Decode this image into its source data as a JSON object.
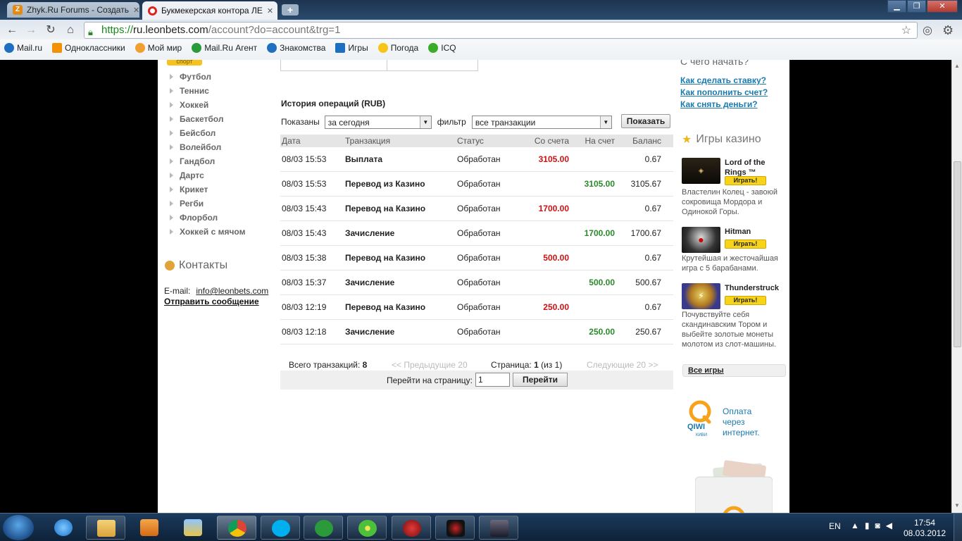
{
  "browser": {
    "tabs": [
      {
        "label": "Zhyk.Ru Forums - Создать"
      },
      {
        "label": "Букмекерская контора ЛЕ"
      }
    ],
    "url_scheme": "https://",
    "url_host": "ru.leonbets.com",
    "url_rest": "/account?do=account&trg=1",
    "bookmarks": [
      {
        "label": "Mail.ru",
        "color": "#1e6fbf"
      },
      {
        "label": "Одноклассники",
        "color": "#f39200"
      },
      {
        "label": "Мой мир",
        "color": "#f0a030"
      },
      {
        "label": "Mail.Ru Агент",
        "color": "#2a9a3a"
      },
      {
        "label": "Знакомства",
        "color": "#1e6fbf"
      },
      {
        "label": "Игры",
        "color": "#1e6fbf"
      },
      {
        "label": "Погода",
        "color": "#f5c518"
      },
      {
        "label": "ICQ",
        "color": "#3cab2a"
      }
    ]
  },
  "sidebar": {
    "tag": "спорт",
    "sports": [
      "Футбол",
      "Теннис",
      "Хоккей",
      "Баскетбол",
      "Бейсбол",
      "Волейбол",
      "Гандбол",
      "Дартс",
      "Крикет",
      "Регби",
      "Флорбол",
      "Хоккей с мячом"
    ],
    "contacts_title": "Контакты",
    "email_label": "E-mail:",
    "email": "info@leonbets.com",
    "send_message": "Отправить сообщение"
  },
  "history": {
    "title": "История операций (RUB)",
    "shown_label": "Показаны",
    "period": "за сегодня",
    "filter_label": "фильтр",
    "filter_value": "все транзакции",
    "show_button": "Показать",
    "columns": {
      "date": "Дата",
      "tx": "Транзакция",
      "status": "Статус",
      "from": "Со счета",
      "to": "На счет",
      "balance": "Баланс"
    },
    "rows": [
      {
        "date": "08/03 15:53",
        "tx": "Выплата",
        "status": "Обработан",
        "from": "3105.00",
        "to": "",
        "balance": "0.67"
      },
      {
        "date": "08/03 15:53",
        "tx": "Перевод из Казино",
        "status": "Обработан",
        "from": "",
        "to": "3105.00",
        "balance": "3105.67"
      },
      {
        "date": "08/03 15:43",
        "tx": "Перевод на Казино",
        "status": "Обработан",
        "from": "1700.00",
        "to": "",
        "balance": "0.67"
      },
      {
        "date": "08/03 15:43",
        "tx": "Зачисление",
        "status": "Обработан",
        "from": "",
        "to": "1700.00",
        "balance": "1700.67"
      },
      {
        "date": "08/03 15:38",
        "tx": "Перевод на Казино",
        "status": "Обработан",
        "from": "500.00",
        "to": "",
        "balance": "0.67"
      },
      {
        "date": "08/03 15:37",
        "tx": "Зачисление",
        "status": "Обработан",
        "from": "",
        "to": "500.00",
        "balance": "500.67"
      },
      {
        "date": "08/03 12:19",
        "tx": "Перевод на Казино",
        "status": "Обработан",
        "from": "250.00",
        "to": "",
        "balance": "0.67"
      },
      {
        "date": "08/03 12:18",
        "tx": "Зачисление",
        "status": "Обработан",
        "from": "",
        "to": "250.00",
        "balance": "250.67"
      }
    ],
    "pager": {
      "total_label": "Всего транзакций:",
      "total": "8",
      "prev": "<< Предыдущие 20",
      "page_label": "Страница:",
      "page": "1",
      "page_of": "(из 1)",
      "next": "Следующие 20 >>",
      "goto_label": "Перейти на страницу:",
      "goto_value": "1",
      "goto_button": "Перейти"
    }
  },
  "right": {
    "start_title": "С чего начать?",
    "help_links": [
      "Как сделать ставку?",
      "Как пополнить счет?",
      "Как снять деньги?"
    ],
    "casino_title": "Игры казино",
    "games": [
      {
        "name_line1": "Lord of the",
        "name_line2": "Rings ™",
        "play": "Играть!",
        "desc": "Властелин Колец - завоюй сокровища Мордора и Одинокой Горы."
      },
      {
        "name_line1": "Hitman",
        "name_line2": "",
        "play": "Играть!",
        "desc": "Крутейшая и жесточайшая игра с 5 барабанами."
      },
      {
        "name_line1": "Thunderstruck",
        "name_line2": "",
        "play": "Играть!",
        "desc": "Почувствуйте себя скандинавским Тором и выбейте золотые монеты молотом из слот-машины."
      }
    ],
    "all_games": "Все игры",
    "qiwi_brand": "QIWI",
    "qiwi_sub": "КИВИ",
    "qiwi_text": [
      "Оплата",
      "через",
      "интернет."
    ]
  },
  "taskbar": {
    "lang": "EN",
    "time": "17:54",
    "date": "08.03.2012"
  }
}
